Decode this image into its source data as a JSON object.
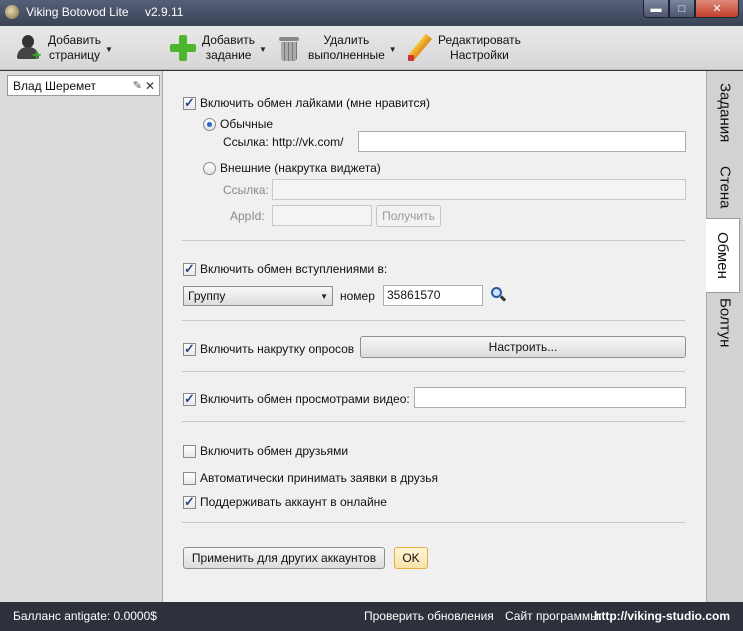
{
  "window": {
    "title": "Viking Botovod Lite",
    "version": "v2.9.11",
    "controls": {
      "minimize": "▬",
      "maximize": "□",
      "close": "✕"
    }
  },
  "toolbar": {
    "add_page": {
      "line1": "Добавить",
      "line2": "страницу",
      "icon": "person-add-icon"
    },
    "add_task": {
      "line1": "Добавить",
      "line2": "задание",
      "icon": "green-plus-icon"
    },
    "delete_done": {
      "line1": "Удалить",
      "line2": "выполненные",
      "icon": "trash-icon"
    },
    "edit_settings": {
      "line1": "Редактировать",
      "line2": "Настройки",
      "icon": "pencil-icon"
    },
    "dropdown_arrow": "▼"
  },
  "accounts": [
    {
      "name": "Влад Шеремет",
      "edit_glyph": "✎",
      "close_glyph": "✕"
    }
  ],
  "likes": {
    "enable_label": "Включить обмен лайками (мне нравится)",
    "enabled": true,
    "normal_label": "Обычные",
    "link_label": "Ссылка: http://vk.com/",
    "link_value": "",
    "external_label": "Внешние (накрутка виджета)",
    "ext_link_label": "Ссылка:",
    "appid_label": "AppId:",
    "get_button": "Получить"
  },
  "joins": {
    "enable_label": "Включить обмен вступлениями в:",
    "enabled": true,
    "target_selected": "Группу",
    "number_label": "номер",
    "number_value": "35861570"
  },
  "polls": {
    "enable_label": "Включить накрутку опросов",
    "enabled": true,
    "configure_button": "Настроить..."
  },
  "video": {
    "enable_label": "Включить обмен просмотрами видео:",
    "enabled": true,
    "value": ""
  },
  "friends": {
    "exchange_label": "Включить обмен друзьями",
    "exchange_enabled": false,
    "auto_accept_label": "Автоматически принимать заявки в друзья",
    "auto_accept_enabled": false,
    "online_label": "Поддерживать аккаунт в онлайне",
    "online_enabled": true
  },
  "actions": {
    "apply_others": "Применить для других аккаунтов",
    "ok": "OK"
  },
  "tabs": [
    {
      "label": "Задания"
    },
    {
      "label": "Стена"
    },
    {
      "label": "Обмен",
      "active": true
    },
    {
      "label": "Болтун"
    }
  ],
  "status": {
    "balance": "Балланс antigate: 0.0000$",
    "check_updates": "Проверить обновления",
    "site_label": "Сайт программы:",
    "site_url": "http://viking-studio.com"
  }
}
